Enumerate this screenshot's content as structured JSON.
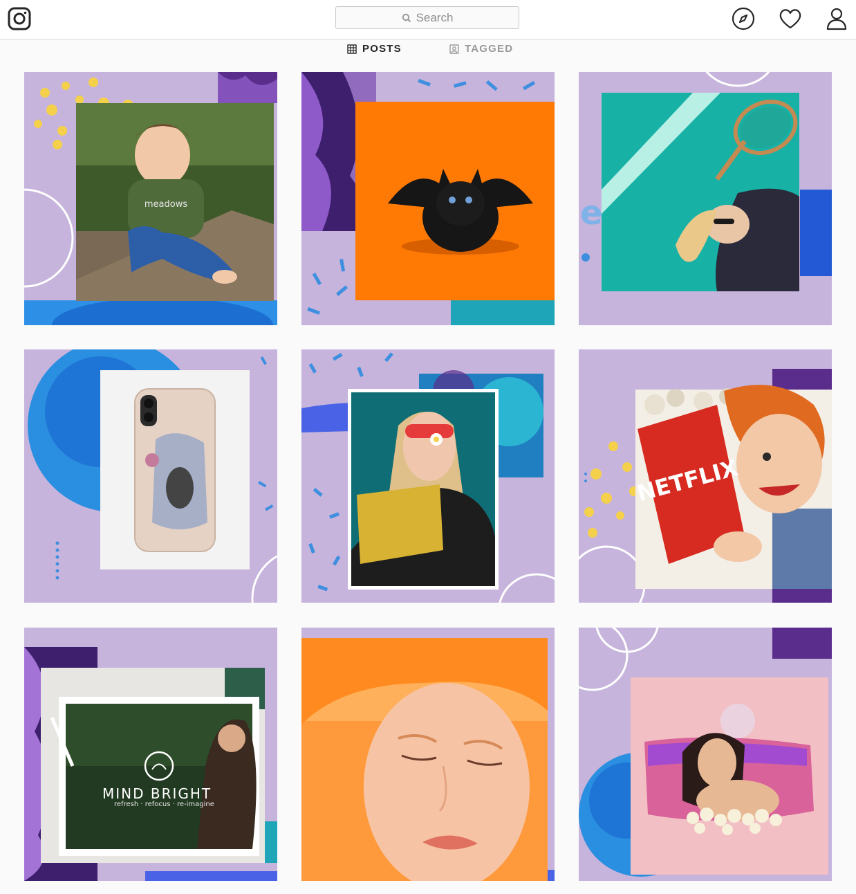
{
  "search": {
    "placeholder": "Search"
  },
  "tabs": [
    {
      "label": "POSTS",
      "active": true,
      "icon": "grid-icon"
    },
    {
      "label": "TAGGED",
      "active": false,
      "icon": "tagged-icon"
    }
  ],
  "nav_icons": [
    "instagram-logo-icon",
    "compass-icon",
    "heart-icon",
    "profile-icon"
  ],
  "posts": [
    {
      "subject": "toddler on bench",
      "shirt_text": "meadows"
    },
    {
      "subject": "black kitten with bat wings"
    },
    {
      "subject": "woman with tennis racket"
    },
    {
      "subject": "phone case"
    },
    {
      "subject": "woman with sunglasses and flower"
    },
    {
      "subject": "vintage woman with book",
      "book_text": "NETFLIX"
    },
    {
      "subject": "mind bright frame",
      "brand_title": "MIND BRIGHT",
      "brand_tagline": "refresh · refocus · re-imagine"
    },
    {
      "subject": "orange haired portrait"
    },
    {
      "subject": "woman collage on pink"
    }
  ],
  "colors": {
    "tile_bg": "#c7b4dc",
    "accent_blue": "#3f8fe0",
    "accent_yellow": "#f5d04a",
    "orange": "#ff7a05",
    "teal": "#17b1a6"
  }
}
